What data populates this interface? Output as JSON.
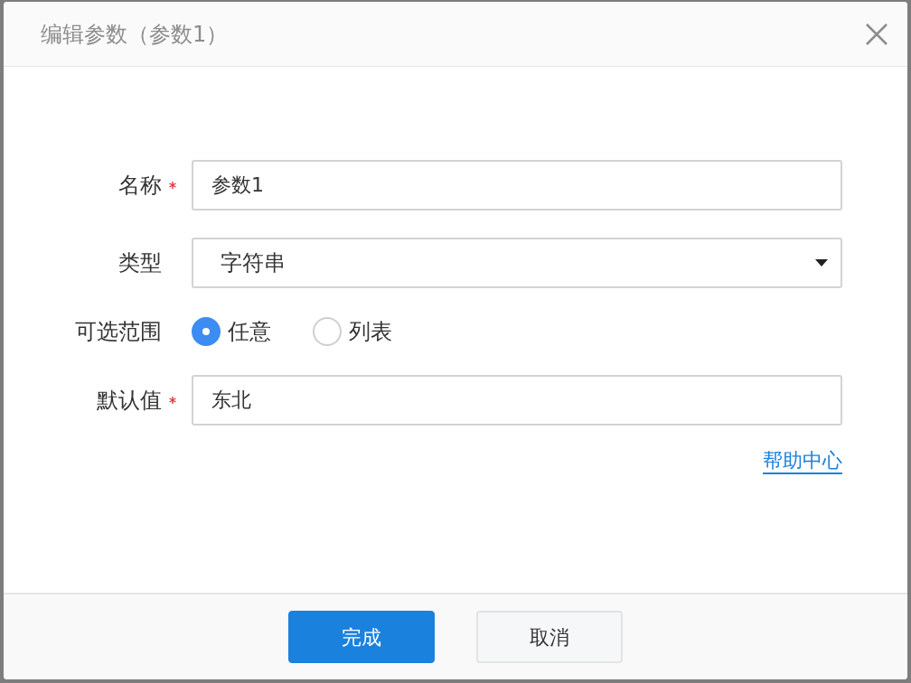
{
  "dialog": {
    "title": "编辑参数（参数1）"
  },
  "fields": [
    {
      "kind": "text",
      "label": "名称",
      "required": true,
      "value": "参数1"
    },
    {
      "kind": "select",
      "label": "类型",
      "required": false,
      "value": "字符串"
    },
    {
      "kind": "radio",
      "label": "可选范围",
      "required": false,
      "options": [
        {
          "label": "任意",
          "selected": true
        },
        {
          "label": "列表",
          "selected": false
        }
      ]
    },
    {
      "kind": "text",
      "label": "默认值",
      "required": true,
      "value": "东北"
    }
  ],
  "help_link": "帮助中心",
  "buttons": [
    {
      "label": "完成",
      "kind": "primary"
    },
    {
      "label": "取消",
      "kind": "secondary"
    }
  ]
}
